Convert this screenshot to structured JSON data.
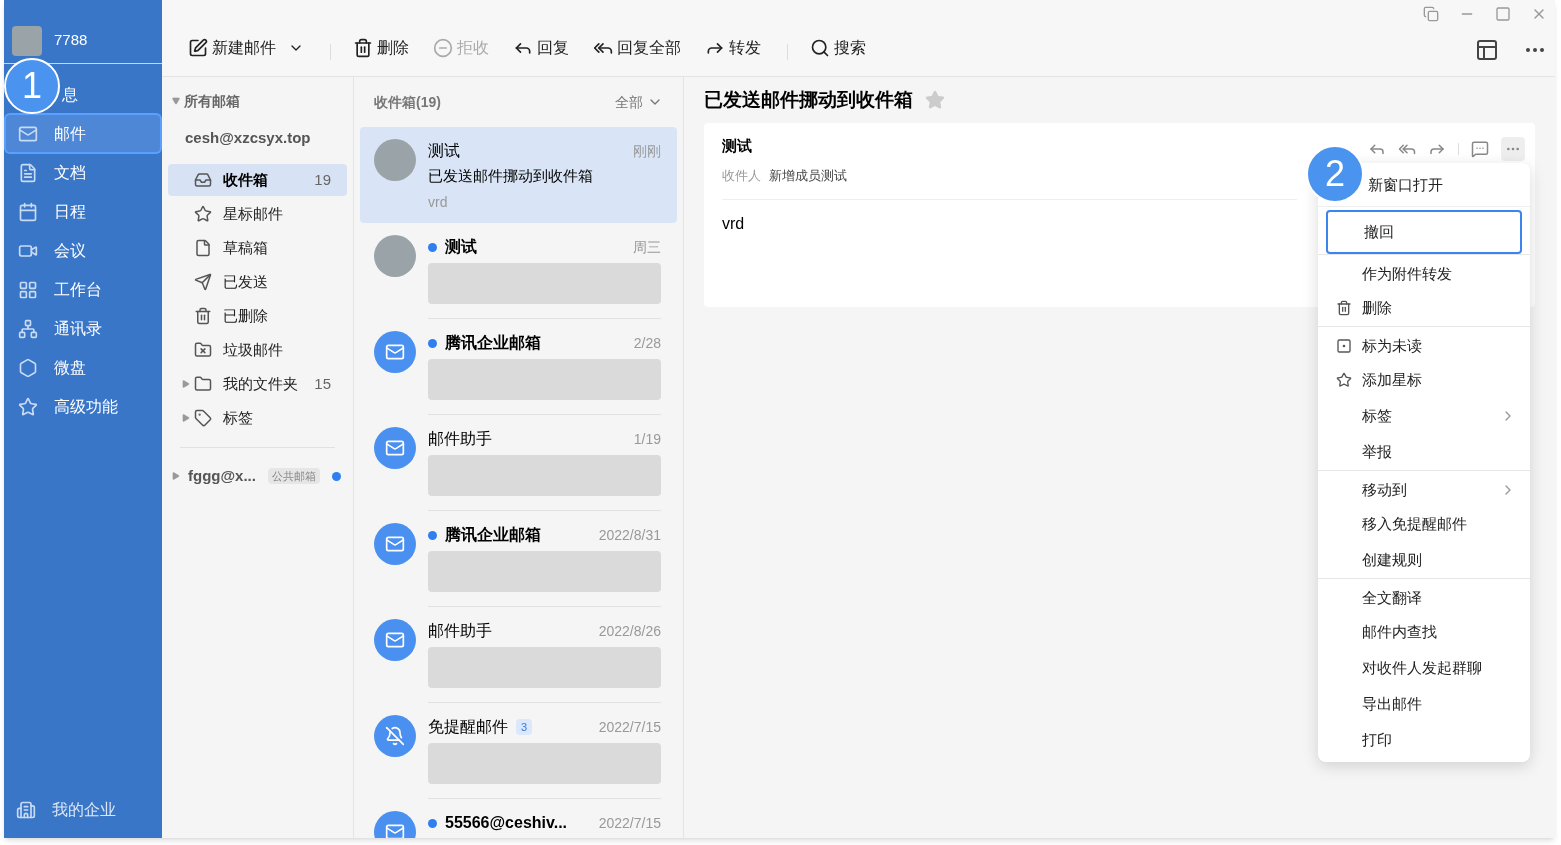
{
  "user": {
    "name": "7788"
  },
  "nav": [
    {
      "label": "息",
      "kind": "chat",
      "selected": false
    },
    {
      "label": "邮件",
      "kind": "mail",
      "selected": true
    },
    {
      "label": "文档",
      "kind": "doc",
      "selected": false
    },
    {
      "label": "日程",
      "kind": "calendar",
      "selected": false
    },
    {
      "label": "会议",
      "kind": "meeting",
      "selected": false
    },
    {
      "label": "工作台",
      "kind": "grid",
      "selected": false
    },
    {
      "label": "通讯录",
      "kind": "contacts",
      "selected": false
    },
    {
      "label": "微盘",
      "kind": "disk",
      "selected": false
    },
    {
      "label": "高级功能",
      "kind": "premium",
      "selected": false
    }
  ],
  "nav_footer": {
    "label": "我的企业"
  },
  "toolbar": [
    {
      "label": "新建邮件",
      "kind": "compose",
      "disabled": false
    },
    {
      "label": "删除",
      "kind": "trash",
      "disabled": false
    },
    {
      "label": "拒收",
      "kind": "block",
      "disabled": true
    },
    {
      "label": "回复",
      "kind": "reply",
      "disabled": false
    },
    {
      "label": "回复全部",
      "kind": "replyall",
      "disabled": false
    },
    {
      "label": "转发",
      "kind": "forward",
      "disabled": false
    },
    {
      "label": "搜索",
      "kind": "search",
      "disabled": false
    }
  ],
  "folders": {
    "header": "所有邮箱",
    "account": "cesh@xzcsyx.top",
    "items": [
      {
        "label": "收件箱",
        "kind": "inbox",
        "count": "19",
        "selected": true
      },
      {
        "label": "星标邮件",
        "kind": "star",
        "selected": false
      },
      {
        "label": "草稿箱",
        "kind": "draft",
        "selected": false
      },
      {
        "label": "已发送",
        "kind": "sent",
        "selected": false
      },
      {
        "label": "已删除",
        "kind": "trash",
        "selected": false
      },
      {
        "label": "垃圾邮件",
        "kind": "spam",
        "selected": false
      },
      {
        "label": "我的文件夹",
        "kind": "folder",
        "count": "15",
        "expandable": true,
        "selected": false
      },
      {
        "label": "标签",
        "kind": "tag",
        "expandable": true,
        "selected": false
      }
    ],
    "other_account": {
      "name": "fggg@x...",
      "badge": "公共邮箱",
      "unread": true
    }
  },
  "list": {
    "title": "收件箱(19)",
    "filter": "全部",
    "items": [
      {
        "kind": "photo",
        "sender": "测试",
        "time": "刚刚",
        "subject": "已发送邮件挪动到收件箱",
        "preview": "vrd",
        "unread": false,
        "selected": true
      },
      {
        "kind": "photo",
        "sender": "测试",
        "time": "周三",
        "unread": true,
        "selected": false
      },
      {
        "kind": "mail",
        "sender": "腾讯企业邮箱",
        "time": "2/28",
        "unread": true,
        "selected": false
      },
      {
        "kind": "mail",
        "sender": "邮件助手",
        "time": "1/19",
        "unread": false,
        "selected": false
      },
      {
        "kind": "mail",
        "sender": "腾讯企业邮箱",
        "time": "2022/8/31",
        "unread": true,
        "selected": false
      },
      {
        "kind": "mail",
        "sender": "邮件助手",
        "time": "2022/8/26",
        "unread": false,
        "selected": false
      },
      {
        "kind": "mute",
        "sender": "免提醒邮件",
        "count": "3",
        "time": "2022/7/15",
        "unread": false,
        "selected": false
      },
      {
        "kind": "mail",
        "sender": "55566@ceshiv...",
        "time": "2022/7/15",
        "unread": true,
        "selected": false
      }
    ]
  },
  "reader": {
    "title": "已发送邮件挪动到收件箱",
    "starred": false,
    "sender": "测试",
    "recipient_label": "收件人",
    "recipient": "新增成员测试",
    "body": "vrd"
  },
  "menu": [
    {
      "label": "新窗口打开",
      "kind": "plain",
      "selected": false
    },
    {
      "label": "撤回",
      "kind": "plain",
      "selected": true,
      "divider_before": true
    },
    {
      "label": "作为附件转发",
      "kind": "plain",
      "selected": false,
      "divider_before": true
    },
    {
      "label": "删除",
      "kind": "trash",
      "selected": false
    },
    {
      "label": "标为未读",
      "kind": "unread",
      "selected": false,
      "divider_before": true
    },
    {
      "label": "添加星标",
      "kind": "star",
      "selected": false
    },
    {
      "label": "标签",
      "kind": "plain",
      "submenu": true,
      "selected": false
    },
    {
      "label": "举报",
      "kind": "plain",
      "selected": false
    },
    {
      "label": "移动到",
      "kind": "plain",
      "submenu": true,
      "selected": false,
      "divider_before": true
    },
    {
      "label": "移入免提醒邮件",
      "kind": "plain",
      "selected": false
    },
    {
      "label": "创建规则",
      "kind": "plain",
      "selected": false
    },
    {
      "label": "全文翻译",
      "kind": "plain",
      "selected": false,
      "divider_before": true
    },
    {
      "label": "邮件内查找",
      "kind": "plain",
      "selected": false
    },
    {
      "label": "对收件人发起群聊",
      "kind": "plain",
      "selected": false
    },
    {
      "label": "导出邮件",
      "kind": "plain",
      "selected": false
    },
    {
      "label": "打印",
      "kind": "plain",
      "selected": false
    }
  ],
  "callouts": [
    "1",
    "2"
  ]
}
